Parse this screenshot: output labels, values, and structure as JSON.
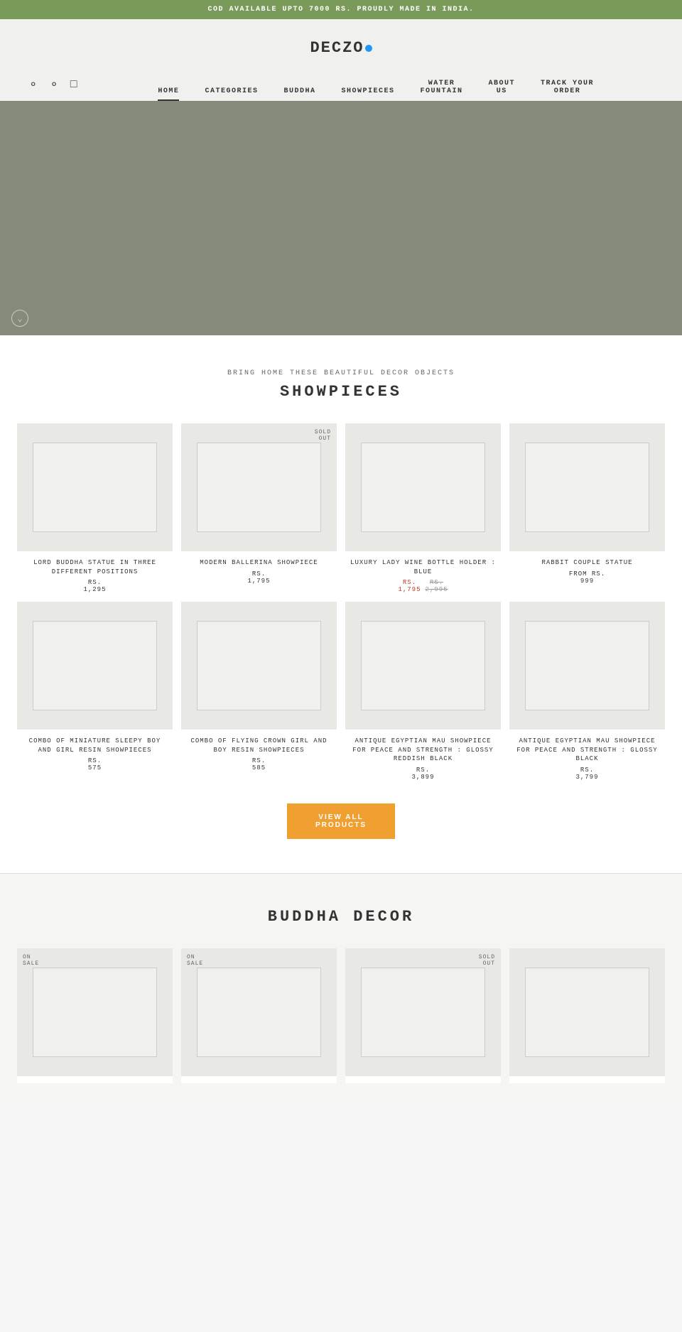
{
  "announcement": {
    "text": "COD AVAILABLE UPTO 7000 RS. PROUDLY MADE IN INDIA."
  },
  "logo": {
    "text": "DECZO"
  },
  "icons": {
    "account": "👤",
    "search": "🔍",
    "cart": "🛍"
  },
  "nav": {
    "items": [
      {
        "label": "HOME",
        "active": true
      },
      {
        "label": "CATEGORIES",
        "active": false
      },
      {
        "label": "BUDDHA",
        "active": false
      },
      {
        "label": "SHOWPIECES",
        "active": false
      },
      {
        "label": "WATER\nFOUNTAIN",
        "active": false
      },
      {
        "label": "ABOUT\nUS",
        "active": false
      },
      {
        "label": "TRACK YOUR\nORDER",
        "active": false
      }
    ]
  },
  "showpieces": {
    "subtitle": "BRING HOME THESE BEAUTIFUL DECOR OBJECTS",
    "title": "SHOWPIECES",
    "products": [
      {
        "title": "LORD BUDDHA STATUE IN THREE DIFFERENT POSITIONS",
        "price_label": "RS.",
        "price": "1,295",
        "sale": false,
        "sold_out": false
      },
      {
        "title": "MODERN BALLERINA SHOWPIECE",
        "price_label": "RS.",
        "price": "1,795",
        "sale": false,
        "sold_out": true
      },
      {
        "title": "LUXURY LADY WINE BOTTLE HOLDER : BLUE",
        "price_label": "RS.",
        "price": "1,795",
        "original_price": "2,995",
        "sale": true,
        "sold_out": false
      },
      {
        "title": "RABBIT COUPLE STATUE",
        "price_label": "FROM RS.",
        "price": "999",
        "sale": false,
        "sold_out": false
      },
      {
        "title": "COMBO OF MINIATURE SLEEPY BOY AND GIRL RESIN SHOWPIECES",
        "price_label": "RS.",
        "price": "575",
        "sale": false,
        "sold_out": false
      },
      {
        "title": "COMBO OF FLYING CROWN GIRL AND BOY RESIN SHOWPIECES",
        "price_label": "RS.",
        "price": "585",
        "sale": false,
        "sold_out": false
      },
      {
        "title": "ANTIQUE EGYPTIAN MAU SHOWPIECE FOR PEACE AND STRENGTH : GLOSSY REDDISH BLACK",
        "price_label": "RS.",
        "price": "3,899",
        "sale": false,
        "sold_out": false
      },
      {
        "title": "ANTIQUE EGYPTIAN MAU SHOWPIECE FOR PEACE AND STRENGTH : GLOSSY BLACK",
        "price_label": "RS.",
        "price": "3,799",
        "sale": false,
        "sold_out": false
      }
    ],
    "view_all_label": "VIEW ALL\nPRODUCTS"
  },
  "buddha_decor": {
    "title": "BUDDHA DECOR",
    "products": [
      {
        "on_sale": true,
        "sold_out": false
      },
      {
        "on_sale": true,
        "sold_out": false
      },
      {
        "on_sale": false,
        "sold_out": true
      }
    ]
  }
}
